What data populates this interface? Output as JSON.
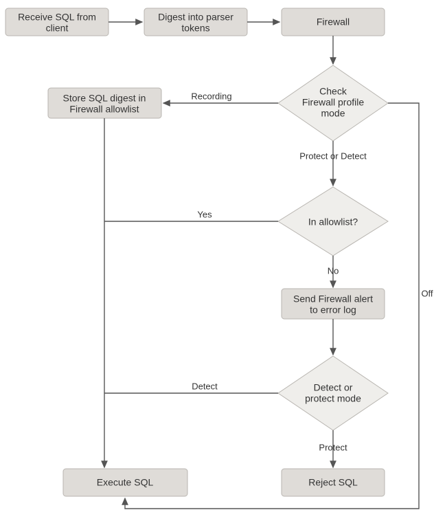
{
  "nodes": {
    "receive": {
      "line1": "Receive SQL from",
      "line2": "client"
    },
    "digest": {
      "line1": "Digest into parser",
      "line2": "tokens"
    },
    "firewall": {
      "line1": "Firewall"
    },
    "check_mode": {
      "line1": "Check",
      "line2": "Firewall profile",
      "line3": "mode"
    },
    "store_allowlist": {
      "line1": "Store SQL digest in",
      "line2": "Firewall allowlist"
    },
    "in_allowlist": {
      "line1": "In allowlist?"
    },
    "send_alert": {
      "line1": "Send Firewall alert",
      "line2": "to error log"
    },
    "detect_protect": {
      "line1": "Detect or",
      "line2": "protect mode"
    },
    "execute": {
      "line1": "Execute SQL"
    },
    "reject": {
      "line1": "Reject SQL"
    }
  },
  "edges": {
    "recording": "Recording",
    "protect_or_detect": "Protect or Detect",
    "yes": "Yes",
    "no": "No",
    "detect": "Detect",
    "protect": "Protect",
    "off": "Off"
  }
}
